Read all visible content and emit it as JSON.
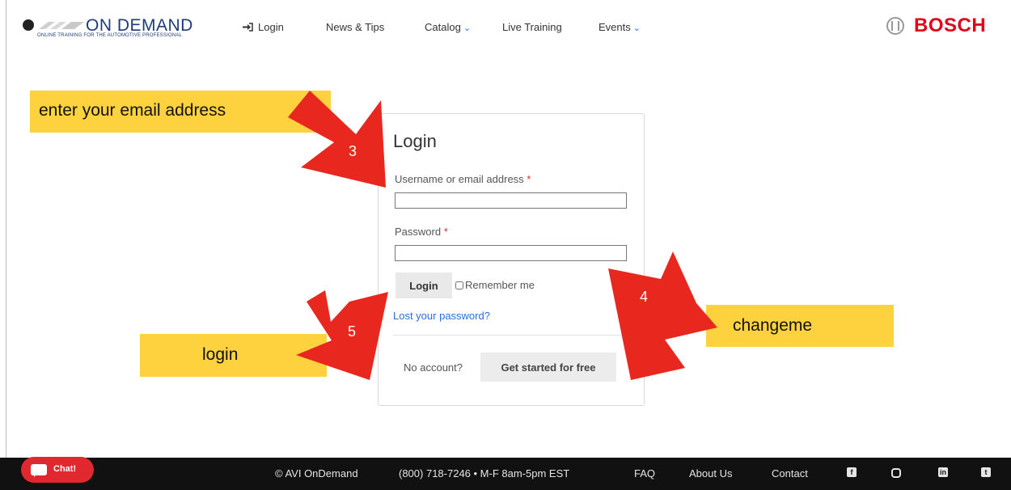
{
  "header": {
    "logo_text": "ON DEMAND",
    "logo_sub": "ONLINE TRAINING FOR THE AUTOMOTIVE PROFESSIONAL",
    "nav": {
      "login": "Login",
      "news": "News & Tips",
      "catalog": "Catalog",
      "live": "Live Training",
      "events": "Events"
    },
    "brand": "BOSCH"
  },
  "login_form": {
    "title": "Login",
    "username_label": "Username or email address",
    "username_value": "",
    "password_label": "Password",
    "password_value": "",
    "required_mark": "*",
    "login_button": "Login",
    "remember_label": "Remember me",
    "remember_checked": false,
    "lost_password": "Lost your password?",
    "no_account": "No account?",
    "get_started": "Get started for free"
  },
  "annotations": {
    "email_callout": "enter your email address",
    "password_callout": "changeme",
    "login_callout": "login",
    "step3": "3",
    "step4": "4",
    "step5": "5",
    "callout_color": "#fdd23e",
    "arrow_color": "#e8281e"
  },
  "footer": {
    "copyright": "© AVI OnDemand",
    "phone": "(800) 718-7246 • M-F 8am-5pm EST",
    "faq": "FAQ",
    "about": "About Us",
    "contact": "Contact",
    "chat": "Chat!"
  },
  "icons": [
    "login-arrow-icon",
    "catalog-chevron-icon",
    "events-chevron-icon",
    "facebook-icon",
    "instagram-icon",
    "linkedin-icon",
    "twitter-icon",
    "chat-bubble-icon"
  ]
}
